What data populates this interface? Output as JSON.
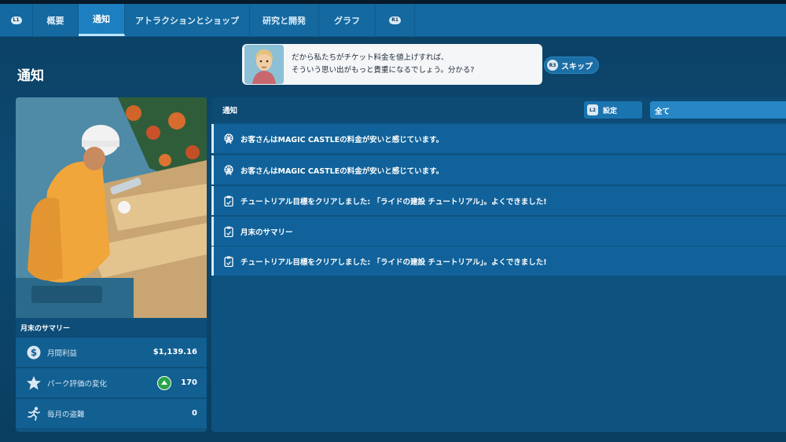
{
  "tabs": {
    "left_hint": "L1",
    "right_hint": "R1",
    "items": [
      "概要",
      "通知",
      "アトラクションとショップ",
      "研究と開発",
      "グラフ"
    ],
    "active_index": 1
  },
  "page": {
    "title": "通知"
  },
  "dialog": {
    "line1": "だから私たちがチケット料金を値上げすれば、",
    "line2": "そういう思い出がもっと貴重になるでしょう。分かる?"
  },
  "skip": {
    "hint": "R3",
    "label": "スキップ"
  },
  "card": {
    "title": "月末のサマリー",
    "stats": [
      {
        "icon": "dollar-icon",
        "label": "月間利益",
        "value": "$1,139.16"
      },
      {
        "icon": "star-icon",
        "label": "パーク評価の変化",
        "value": "170",
        "trend": "up"
      },
      {
        "icon": "running-thief-icon",
        "label": "毎月の盗難",
        "value": "0"
      }
    ]
  },
  "panel": {
    "title": "通知",
    "settings_hint": "L2",
    "settings_label": "設定",
    "filter_value": "全て",
    "notifications": [
      {
        "icon": "ferris-wheel-icon",
        "text": "お客さんはMAGIC CASTLEの料金が安いと感じています。"
      },
      {
        "icon": "ferris-wheel-icon",
        "text": "お客さんはMAGIC CASTLEの料金が安いと感じています。"
      },
      {
        "icon": "clipboard-icon",
        "text": "チュートリアル目標をクリアしました: 「ライドの建設 チュートリアル」。よくできました!"
      },
      {
        "icon": "clipboard-icon",
        "text": "月末のサマリー"
      },
      {
        "icon": "clipboard-icon",
        "text": "チュートリアル目標をクリアしました: 「ライドの建設 チュートリアル」。よくできました!"
      }
    ]
  },
  "colors": {
    "background": "#0d4a72",
    "tabbar": "#1469a0",
    "active_tab": "#1d7fbf",
    "notification_row": "#11629a",
    "trend_up": "#2aa34a"
  }
}
